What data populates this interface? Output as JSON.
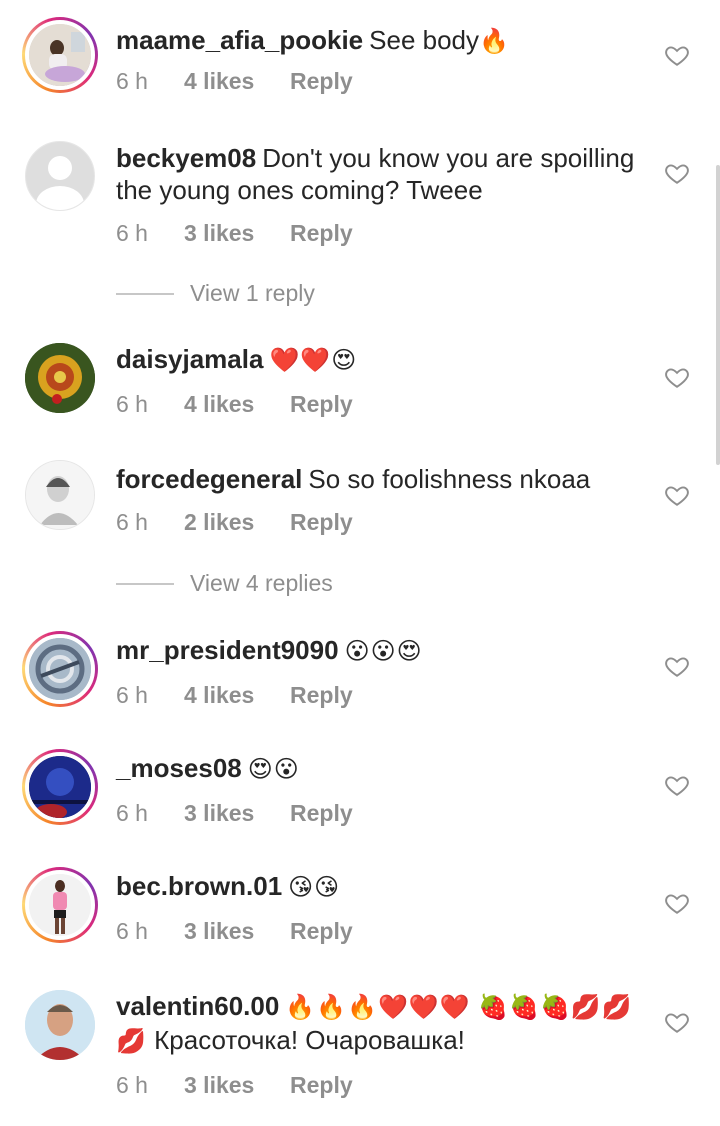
{
  "comments": [
    {
      "username": "maame_afia_pookie",
      "text": "See body",
      "emoji": "🔥",
      "time": "6 h",
      "likes": "4 likes",
      "reply": "Reply",
      "ring": true,
      "avatar_icon": "photo-woman-sitting"
    },
    {
      "username": "beckyem08",
      "text": "Don't you know you are spoilling the young ones  coming? Tweee",
      "emoji": "",
      "time": "6 h",
      "likes": "3 likes",
      "reply": "Reply",
      "ring": false,
      "avatar_icon": "default-user-icon"
    },
    {
      "username": "daisyjamala",
      "text": "",
      "emoji": "❤️❤️😍",
      "time": "6 h",
      "likes": "4 likes",
      "reply": "Reply",
      "ring": false,
      "avatar_icon": "photo-flower"
    },
    {
      "username": "forcedegeneral",
      "text": "So so foolishness nkoaa",
      "emoji": "",
      "time": "6 h",
      "likes": "2 likes",
      "reply": "Reply",
      "ring": false,
      "avatar_icon": "photo-man-sketch"
    },
    {
      "username": "mr_president9090",
      "text": "",
      "emoji": "😮😮😍",
      "time": "6 h",
      "likes": "4 likes",
      "reply": "Reply",
      "ring": true,
      "avatar_icon": "photo-swirl-logo"
    },
    {
      "username": "_moses08",
      "text": "",
      "emoji": "😍😮",
      "time": "6 h",
      "likes": "3 likes",
      "reply": "Reply",
      "ring": true,
      "avatar_icon": "photo-blue-night"
    },
    {
      "username": "bec.brown.01",
      "text": "",
      "emoji": "😘😘",
      "time": "6 h",
      "likes": "3 likes",
      "reply": "Reply",
      "ring": true,
      "avatar_icon": "photo-woman-pink"
    },
    {
      "username": "valentin60.00",
      "text": "Красоточка! Очаровашка!",
      "emoji": "🔥🔥🔥❤️❤️❤️ 🍓🍓🍓💋💋💋",
      "time": "6 h",
      "likes": "3 likes",
      "reply": "Reply",
      "ring": false,
      "avatar_icon": "photo-man-portrait"
    }
  ],
  "view_replies": [
    {
      "label": "View 1 reply"
    },
    {
      "label": "View 4 replies"
    }
  ],
  "icons": {
    "like": "heart-outline-icon"
  },
  "colors": {
    "muted": "#8e8e8e",
    "text": "#262626",
    "ring_start": "#f58529",
    "ring_end": "#dd2a7b"
  }
}
